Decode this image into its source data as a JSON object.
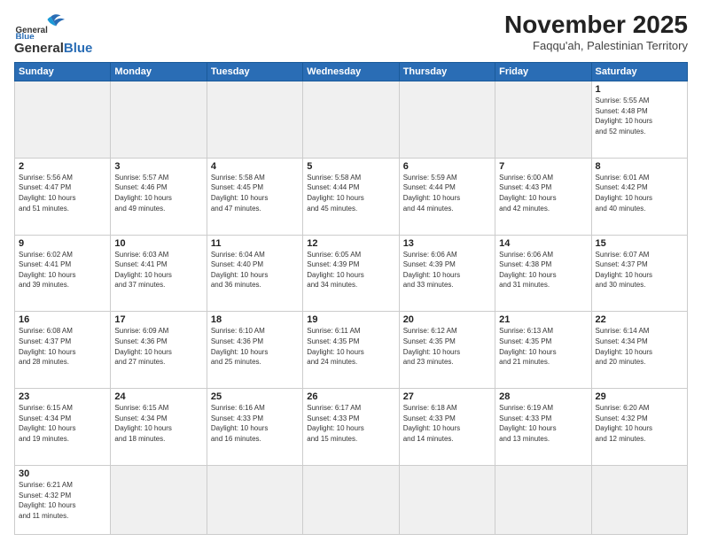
{
  "header": {
    "logo_general": "General",
    "logo_blue": "Blue",
    "month": "November 2025",
    "location": "Faqqu'ah, Palestinian Territory"
  },
  "weekdays": [
    "Sunday",
    "Monday",
    "Tuesday",
    "Wednesday",
    "Thursday",
    "Friday",
    "Saturday"
  ],
  "days": {
    "1": {
      "sunrise": "5:55 AM",
      "sunset": "4:48 PM",
      "daylight": "10 hours and 52 minutes."
    },
    "2": {
      "sunrise": "5:56 AM",
      "sunset": "4:47 PM",
      "daylight": "10 hours and 51 minutes."
    },
    "3": {
      "sunrise": "5:57 AM",
      "sunset": "4:46 PM",
      "daylight": "10 hours and 49 minutes."
    },
    "4": {
      "sunrise": "5:58 AM",
      "sunset": "4:45 PM",
      "daylight": "10 hours and 47 minutes."
    },
    "5": {
      "sunrise": "5:58 AM",
      "sunset": "4:44 PM",
      "daylight": "10 hours and 45 minutes."
    },
    "6": {
      "sunrise": "5:59 AM",
      "sunset": "4:44 PM",
      "daylight": "10 hours and 44 minutes."
    },
    "7": {
      "sunrise": "6:00 AM",
      "sunset": "4:43 PM",
      "daylight": "10 hours and 42 minutes."
    },
    "8": {
      "sunrise": "6:01 AM",
      "sunset": "4:42 PM",
      "daylight": "10 hours and 40 minutes."
    },
    "9": {
      "sunrise": "6:02 AM",
      "sunset": "4:41 PM",
      "daylight": "10 hours and 39 minutes."
    },
    "10": {
      "sunrise": "6:03 AM",
      "sunset": "4:41 PM",
      "daylight": "10 hours and 37 minutes."
    },
    "11": {
      "sunrise": "6:04 AM",
      "sunset": "4:40 PM",
      "daylight": "10 hours and 36 minutes."
    },
    "12": {
      "sunrise": "6:05 AM",
      "sunset": "4:39 PM",
      "daylight": "10 hours and 34 minutes."
    },
    "13": {
      "sunrise": "6:06 AM",
      "sunset": "4:39 PM",
      "daylight": "10 hours and 33 minutes."
    },
    "14": {
      "sunrise": "6:06 AM",
      "sunset": "4:38 PM",
      "daylight": "10 hours and 31 minutes."
    },
    "15": {
      "sunrise": "6:07 AM",
      "sunset": "4:37 PM",
      "daylight": "10 hours and 30 minutes."
    },
    "16": {
      "sunrise": "6:08 AM",
      "sunset": "4:37 PM",
      "daylight": "10 hours and 28 minutes."
    },
    "17": {
      "sunrise": "6:09 AM",
      "sunset": "4:36 PM",
      "daylight": "10 hours and 27 minutes."
    },
    "18": {
      "sunrise": "6:10 AM",
      "sunset": "4:36 PM",
      "daylight": "10 hours and 25 minutes."
    },
    "19": {
      "sunrise": "6:11 AM",
      "sunset": "4:35 PM",
      "daylight": "10 hours and 24 minutes."
    },
    "20": {
      "sunrise": "6:12 AM",
      "sunset": "4:35 PM",
      "daylight": "10 hours and 23 minutes."
    },
    "21": {
      "sunrise": "6:13 AM",
      "sunset": "4:35 PM",
      "daylight": "10 hours and 21 minutes."
    },
    "22": {
      "sunrise": "6:14 AM",
      "sunset": "4:34 PM",
      "daylight": "10 hours and 20 minutes."
    },
    "23": {
      "sunrise": "6:15 AM",
      "sunset": "4:34 PM",
      "daylight": "10 hours and 19 minutes."
    },
    "24": {
      "sunrise": "6:15 AM",
      "sunset": "4:34 PM",
      "daylight": "10 hours and 18 minutes."
    },
    "25": {
      "sunrise": "6:16 AM",
      "sunset": "4:33 PM",
      "daylight": "10 hours and 16 minutes."
    },
    "26": {
      "sunrise": "6:17 AM",
      "sunset": "4:33 PM",
      "daylight": "10 hours and 15 minutes."
    },
    "27": {
      "sunrise": "6:18 AM",
      "sunset": "4:33 PM",
      "daylight": "10 hours and 14 minutes."
    },
    "28": {
      "sunrise": "6:19 AM",
      "sunset": "4:33 PM",
      "daylight": "10 hours and 13 minutes."
    },
    "29": {
      "sunrise": "6:20 AM",
      "sunset": "4:32 PM",
      "daylight": "10 hours and 12 minutes."
    },
    "30": {
      "sunrise": "6:21 AM",
      "sunset": "4:32 PM",
      "daylight": "10 hours and 11 minutes."
    }
  }
}
